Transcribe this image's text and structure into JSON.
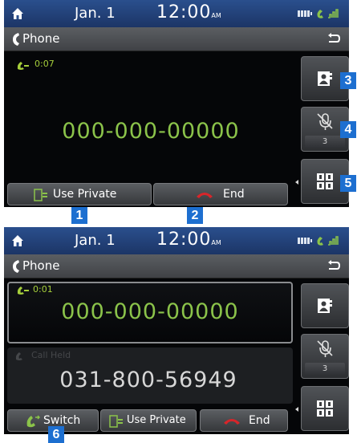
{
  "screen1": {
    "status": {
      "date": "Jan.  1",
      "time": "12:00",
      "ampm": "AM"
    },
    "title": "Phone",
    "call": {
      "timer": "0:07",
      "number": "000-000-00000"
    },
    "side": {
      "mute_count": "3"
    },
    "buttons": {
      "use_private": "Use Private",
      "end": "End"
    }
  },
  "screen2": {
    "status": {
      "date": "Jan.  1",
      "time": "12:00",
      "ampm": "AM"
    },
    "title": "Phone",
    "active_call": {
      "timer": "0:01",
      "number": "000-000-00000"
    },
    "held_call": {
      "status": "Call Held",
      "number": "031-800-56949"
    },
    "side": {
      "mute_count": "3"
    },
    "buttons": {
      "switch": "Switch",
      "use_private": "Use Private",
      "end": "End"
    }
  },
  "callouts": [
    "1",
    "2",
    "3",
    "4",
    "5",
    "6"
  ],
  "colors": {
    "statusbar": "#2a4f8d",
    "number_green": "#8bc34a",
    "timer_green": "#a6cf3b",
    "end_red": "#d8252a",
    "callout_blue": "#1d6fd0"
  }
}
